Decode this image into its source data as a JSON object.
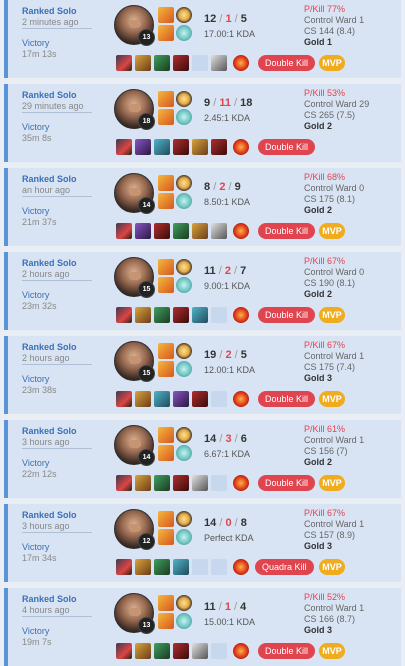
{
  "matches": [
    {
      "queue": "Ranked Solo",
      "time_ago": "2 minutes ago",
      "result": "Victory",
      "duration": "17m 13s",
      "level": "13",
      "kills": "12",
      "deaths": "1",
      "assists": "5",
      "kda": "17.00:1 KDA",
      "pkill": "P/Kill 77%",
      "control_ward": "Control Ward 1",
      "cs": "CS 144 (8.4)",
      "rank": "Gold 1",
      "multikill": "Double Kill",
      "mvp": "MVP"
    },
    {
      "queue": "Ranked Solo",
      "time_ago": "29 minutes ago",
      "result": "Victory",
      "duration": "35m 8s",
      "level": "18",
      "kills": "9",
      "deaths": "11",
      "assists": "18",
      "kda": "2.45:1 KDA",
      "pkill": "P/Kill 53%",
      "control_ward": "Control Ward 29",
      "cs": "CS 265 (7.5)",
      "rank": "Gold 2",
      "multikill": "Double Kill",
      "mvp": ""
    },
    {
      "queue": "Ranked Solo",
      "time_ago": "an hour ago",
      "result": "Victory",
      "duration": "21m 37s",
      "level": "14",
      "kills": "8",
      "deaths": "2",
      "assists": "9",
      "kda": "8.50:1 KDA",
      "pkill": "P/Kill 68%",
      "control_ward": "Control Ward 0",
      "cs": "CS 175 (8.1)",
      "rank": "Gold 2",
      "multikill": "Double Kill",
      "mvp": "MVP"
    },
    {
      "queue": "Ranked Solo",
      "time_ago": "2 hours ago",
      "result": "Victory",
      "duration": "23m 32s",
      "level": "15",
      "kills": "11",
      "deaths": "2",
      "assists": "7",
      "kda": "9.00:1 KDA",
      "pkill": "P/Kill 67%",
      "control_ward": "Control Ward 0",
      "cs": "CS 190 (8.1)",
      "rank": "Gold 2",
      "multikill": "Double Kill",
      "mvp": "MVP"
    },
    {
      "queue": "Ranked Solo",
      "time_ago": "2 hours ago",
      "result": "Victory",
      "duration": "23m 38s",
      "level": "15",
      "kills": "19",
      "deaths": "2",
      "assists": "5",
      "kda": "12.00:1 KDA",
      "pkill": "P/Kill 67%",
      "control_ward": "Control Ward 1",
      "cs": "CS 175 (7.4)",
      "rank": "Gold 3",
      "multikill": "Double Kill",
      "mvp": "MVP"
    },
    {
      "queue": "Ranked Solo",
      "time_ago": "3 hours ago",
      "result": "Victory",
      "duration": "22m 12s",
      "level": "14",
      "kills": "14",
      "deaths": "3",
      "assists": "6",
      "kda": "6.67:1 KDA",
      "pkill": "P/Kill 61%",
      "control_ward": "Control Ward 1",
      "cs": "CS 156 (7)",
      "rank": "Gold 2",
      "multikill": "Double Kill",
      "mvp": "MVP"
    },
    {
      "queue": "Ranked Solo",
      "time_ago": "3 hours ago",
      "result": "Victory",
      "duration": "17m 34s",
      "level": "12",
      "kills": "14",
      "deaths": "0",
      "assists": "8",
      "kda": "Perfect KDA",
      "pkill": "P/Kill 67%",
      "control_ward": "Control Ward 1",
      "cs": "CS 157 (8.9)",
      "rank": "Gold 3",
      "multikill": "Quadra Kill",
      "mvp": "MVP"
    },
    {
      "queue": "Ranked Solo",
      "time_ago": "4 hours ago",
      "result": "Victory",
      "duration": "19m 7s",
      "level": "13",
      "kills": "11",
      "deaths": "1",
      "assists": "4",
      "kda": "15.00:1 KDA",
      "pkill": "P/Kill 52%",
      "control_ward": "Control Ward 1",
      "cs": "CS 166 (8.7)",
      "rank": "Gold 3",
      "multikill": "Double Kill",
      "mvp": "MVP"
    }
  ],
  "slash": "/",
  "colors": {
    "accent": "#3b6fb6",
    "card_bg": "#d8e4f3",
    "deaths": "#e0444f",
    "multikill_badge": "#e0444f",
    "mvp_badge": "#efac1f"
  },
  "icons": {
    "summoner_spell": "spell-icon",
    "rune": "rune-icon",
    "item": "item-icon",
    "trinket": "trinket-icon"
  }
}
